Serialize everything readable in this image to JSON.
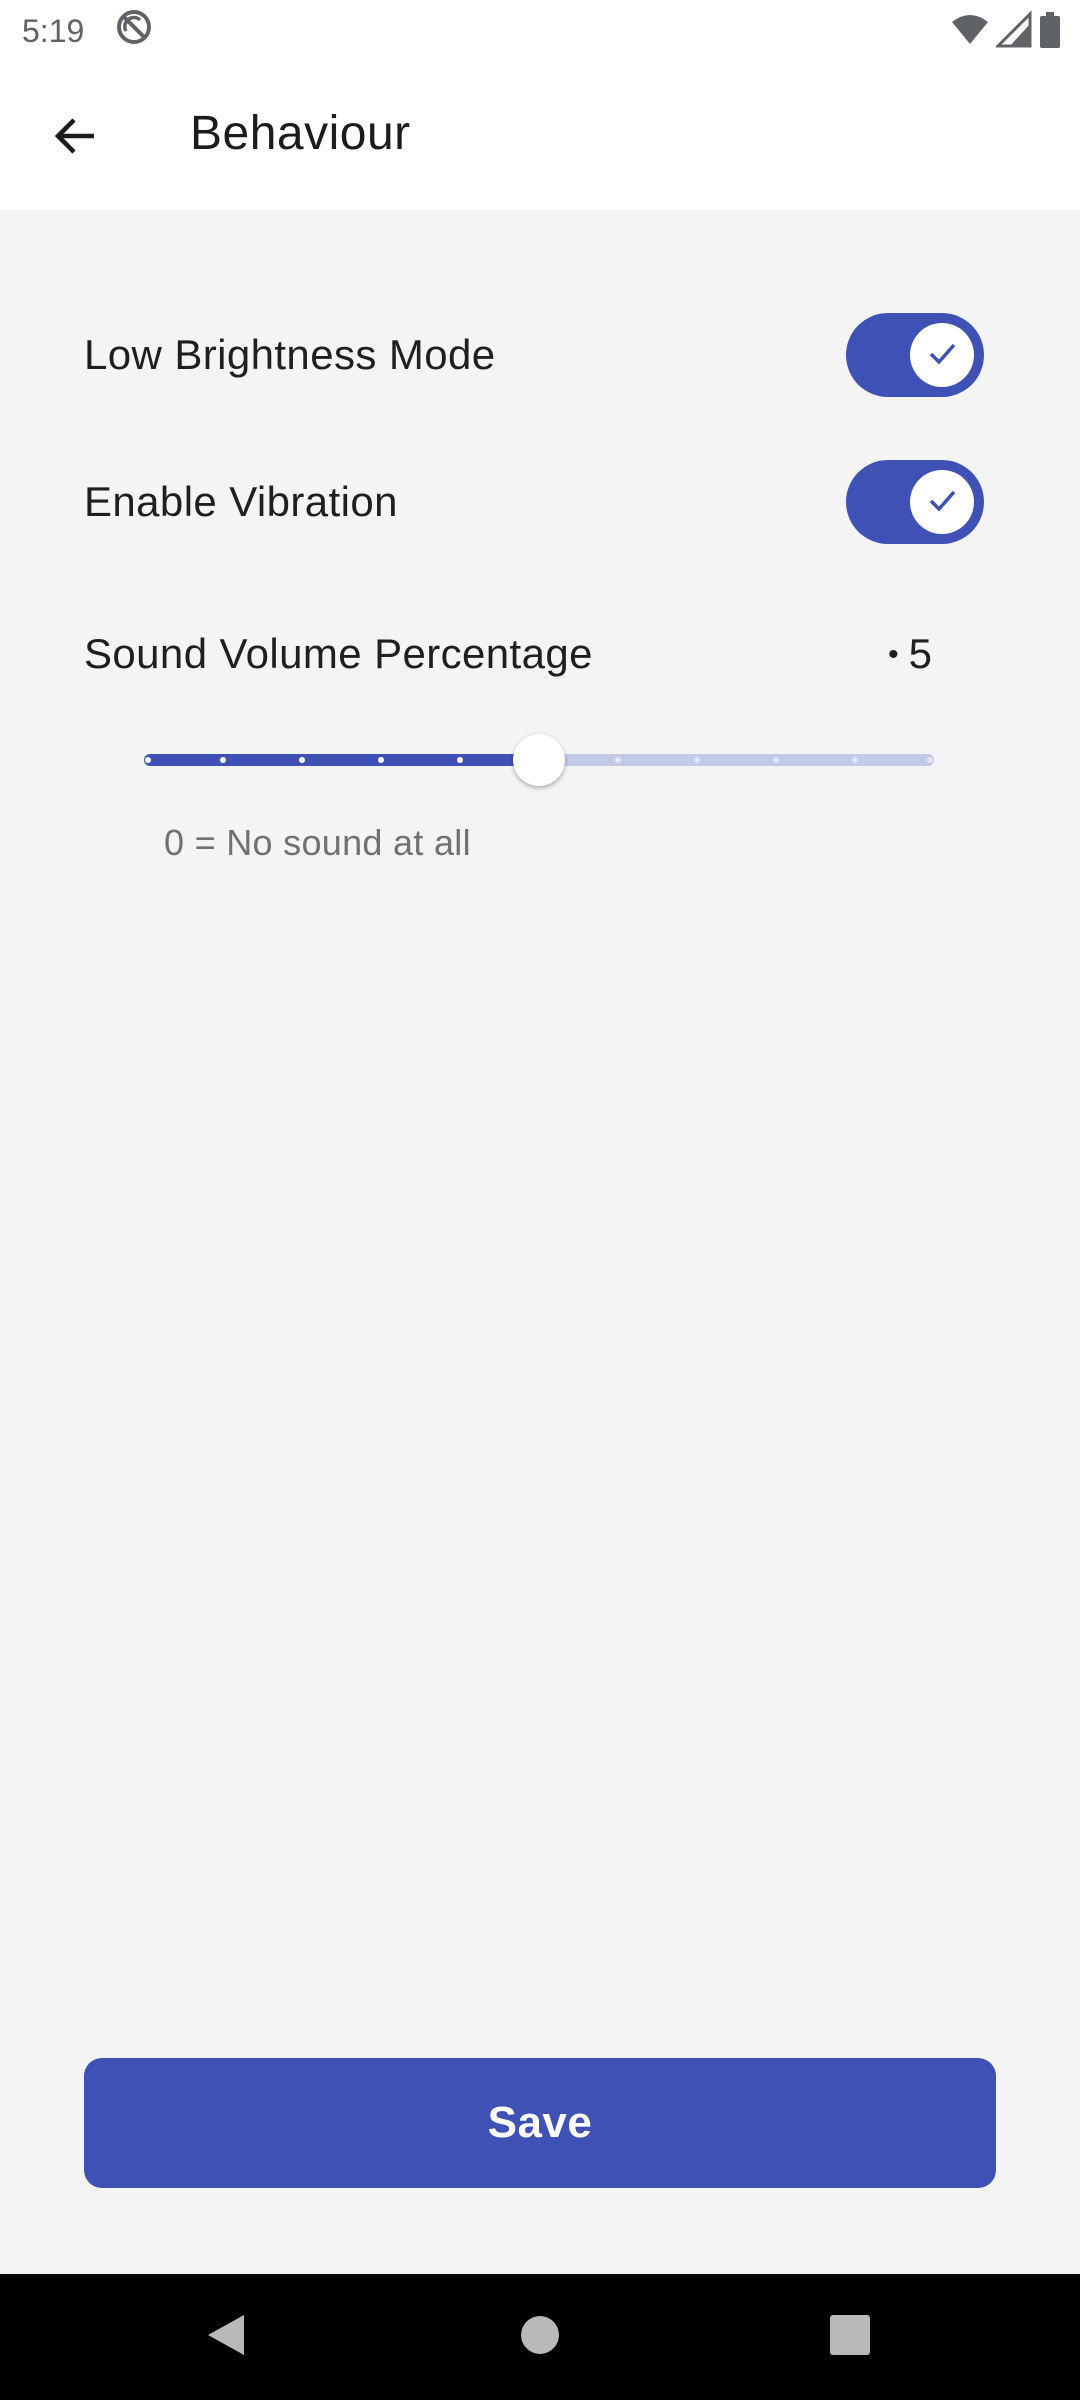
{
  "status_bar": {
    "time": "5:19",
    "icons": [
      "sync-disabled-icon",
      "wifi-icon",
      "cell-signal-icon",
      "battery-icon"
    ]
  },
  "app_bar": {
    "back_icon": "arrow-left-icon",
    "title": "Behaviour"
  },
  "settings": [
    {
      "label": "Low Brightness Mode",
      "enabled": true
    },
    {
      "label": "Enable Vibration",
      "enabled": true
    }
  ],
  "volume": {
    "label": "Sound Volume Percentage",
    "value": "5",
    "min": 0,
    "max": 10,
    "current": 5,
    "hint": "0 = No sound at all"
  },
  "save_label": "Save",
  "colors": {
    "accent": "#3f51b5",
    "track_inactive": "#c3c9e9",
    "background": "#f4f4f5"
  },
  "nav": {
    "back_icon": "nav-back-icon",
    "home_icon": "nav-home-icon",
    "recents_icon": "nav-recents-icon"
  }
}
